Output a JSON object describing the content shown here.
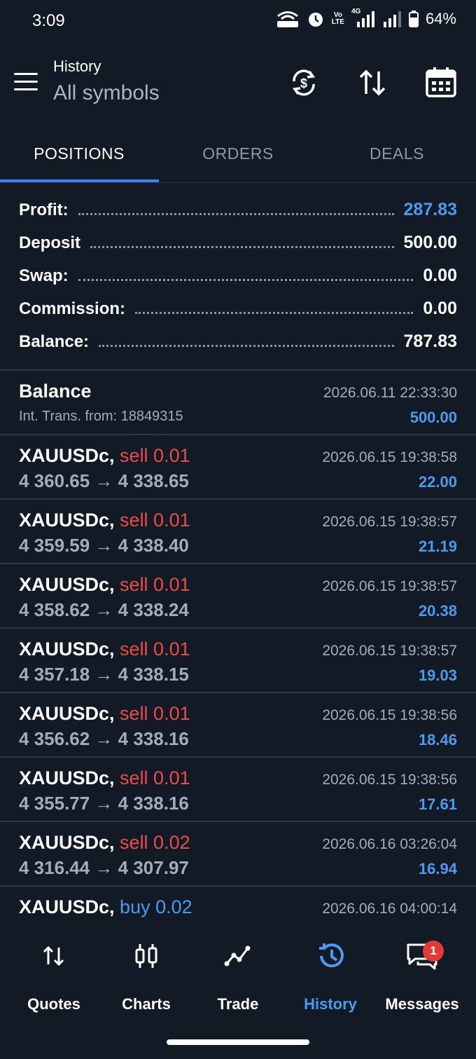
{
  "status": {
    "time": "3:09",
    "battery": "64%",
    "net_label": "4G",
    "volte_label_1": "Vo",
    "volte_label_2": "LTE"
  },
  "header": {
    "title": "History",
    "subtitle": "All symbols"
  },
  "tabs": [
    {
      "label": "POSITIONS"
    },
    {
      "label": "ORDERS"
    },
    {
      "label": "DEALS"
    }
  ],
  "summary": [
    {
      "label": "Profit:",
      "value": "287.83"
    },
    {
      "label": "Deposit",
      "value": "500.00"
    },
    {
      "label": "Swap:",
      "value": "0.00"
    },
    {
      "label": "Commission:",
      "value": "0.00"
    },
    {
      "label": "Balance:",
      "value": "787.83"
    }
  ],
  "balance_entry": {
    "title": "Balance",
    "subtitle": "Int. Trans. from: 18849315",
    "time": "2026.06.11 22:33:30",
    "amount": "500.00"
  },
  "positions": [
    {
      "symbol": "XAUUSDc,",
      "side": "sell 0.01",
      "prices": "4 360.65 → 4 338.65",
      "time": "2026.06.15 19:38:58",
      "profit": "22.00"
    },
    {
      "symbol": "XAUUSDc,",
      "side": "sell 0.01",
      "prices": "4 359.59 → 4 338.40",
      "time": "2026.06.15 19:38:57",
      "profit": "21.19"
    },
    {
      "symbol": "XAUUSDc,",
      "side": "sell 0.01",
      "prices": "4 358.62 → 4 338.24",
      "time": "2026.06.15 19:38:57",
      "profit": "20.38"
    },
    {
      "symbol": "XAUUSDc,",
      "side": "sell 0.01",
      "prices": "4 357.18 → 4 338.15",
      "time": "2026.06.15 19:38:57",
      "profit": "19.03"
    },
    {
      "symbol": "XAUUSDc,",
      "side": "sell 0.01",
      "prices": "4 356.62 → 4 338.16",
      "time": "2026.06.15 19:38:56",
      "profit": "18.46"
    },
    {
      "symbol": "XAUUSDc,",
      "side": "sell 0.01",
      "prices": "4 355.77 → 4 338.16",
      "time": "2026.06.15 19:38:56",
      "profit": "17.61"
    },
    {
      "symbol": "XAUUSDc,",
      "side": "sell 0.02",
      "prices": "4 316.44 → 4 307.97",
      "time": "2026.06.16 03:26:04",
      "profit": "16.94"
    },
    {
      "symbol": "XAUUSDc,",
      "side": "buy 0.02",
      "prices": "",
      "time": "2026.06.16 04:00:14",
      "profit": ""
    }
  ],
  "nav": [
    {
      "label": "Quotes",
      "icon": "quotes-icon"
    },
    {
      "label": "Charts",
      "icon": "charts-icon"
    },
    {
      "label": "Trade",
      "icon": "trade-icon"
    },
    {
      "label": "History",
      "icon": "history-icon"
    },
    {
      "label": "Messages",
      "icon": "messages-icon",
      "badge": "1"
    }
  ],
  "colors": {
    "background": "#121a25",
    "accent": "#4a9bf0",
    "sell": "#ee4a4a",
    "muted": "#a3adba"
  }
}
